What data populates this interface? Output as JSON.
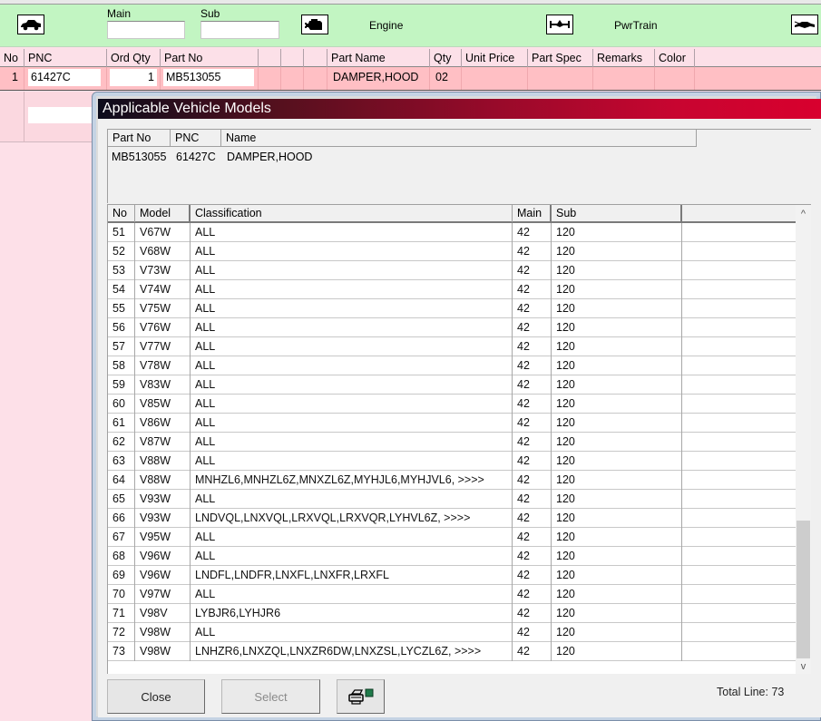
{
  "toolbar": {
    "main_label": "Main",
    "sub_label": "Sub",
    "main_value": "",
    "sub_value": "",
    "engine_label": "Engine",
    "pwrtrain_label": "PwrTrain",
    "icons": [
      "car-icon",
      "engine-icon",
      "powertrain-axle-icon",
      "car-body-icon"
    ]
  },
  "grid": {
    "columns": [
      "No",
      "PNC",
      "Ord Qty",
      "Part No",
      "",
      "",
      "",
      "Part Name",
      "Qty",
      "Unit Price",
      "Part Spec",
      "Remarks",
      "Color"
    ],
    "row": {
      "no": "1",
      "pnc": "61427C",
      "ord_qty": "1",
      "part_no": "MB513055",
      "part_name": "DAMPER,HOOD",
      "qty": "02",
      "unit_price": "",
      "part_spec": "",
      "remarks": "",
      "color": ""
    }
  },
  "dialog": {
    "title": "Applicable Vehicle Models",
    "info": {
      "headers": [
        "Part No",
        "PNC",
        "Name"
      ],
      "values": [
        "MB513055",
        "61427C",
        "DAMPER,HOOD"
      ]
    },
    "table": {
      "headers": [
        "No",
        "Model",
        "Classification",
        "Main",
        "Sub",
        ""
      ],
      "rows": [
        [
          "51",
          "V67W",
          "ALL",
          "42",
          "120"
        ],
        [
          "52",
          "V68W",
          "ALL",
          "42",
          "120"
        ],
        [
          "53",
          "V73W",
          "ALL",
          "42",
          "120"
        ],
        [
          "54",
          "V74W",
          "ALL",
          "42",
          "120"
        ],
        [
          "55",
          "V75W",
          "ALL",
          "42",
          "120"
        ],
        [
          "56",
          "V76W",
          "ALL",
          "42",
          "120"
        ],
        [
          "57",
          "V77W",
          "ALL",
          "42",
          "120"
        ],
        [
          "58",
          "V78W",
          "ALL",
          "42",
          "120"
        ],
        [
          "59",
          "V83W",
          "ALL",
          "42",
          "120"
        ],
        [
          "60",
          "V85W",
          "ALL",
          "42",
          "120"
        ],
        [
          "61",
          "V86W",
          "ALL",
          "42",
          "120"
        ],
        [
          "62",
          "V87W",
          "ALL",
          "42",
          "120"
        ],
        [
          "63",
          "V88W",
          "ALL",
          "42",
          "120"
        ],
        [
          "64",
          "V88W",
          "MNHZL6,MNHZL6Z,MNXZL6Z,MYHJL6,MYHJVL6,  >>>>",
          "42",
          "120"
        ],
        [
          "65",
          "V93W",
          "ALL",
          "42",
          "120"
        ],
        [
          "66",
          "V93W",
          "LNDVQL,LNXVQL,LRXVQL,LRXVQR,LYHVL6Z,  >>>>",
          "42",
          "120"
        ],
        [
          "67",
          "V95W",
          "ALL",
          "42",
          "120"
        ],
        [
          "68",
          "V96W",
          "ALL",
          "42",
          "120"
        ],
        [
          "69",
          "V96W",
          "LNDFL,LNDFR,LNXFL,LNXFR,LRXFL",
          "42",
          "120"
        ],
        [
          "70",
          "V97W",
          "ALL",
          "42",
          "120"
        ],
        [
          "71",
          "V98V",
          "LYBJR6,LYHJR6",
          "42",
          "120"
        ],
        [
          "72",
          "V98W",
          "ALL",
          "42",
          "120"
        ],
        [
          "73",
          "V98W",
          "LNHZR6,LNXZQL,LNXZR6DW,LNXZSL,LYCZL6Z,  >>>>",
          "42",
          "120"
        ]
      ]
    },
    "scroll": {
      "up_icon": "^",
      "down_icon": "v"
    },
    "buttons": {
      "close": "Close",
      "select": "Select",
      "print_icon": "printer-icon"
    },
    "total_line": "Total Line: 73"
  }
}
